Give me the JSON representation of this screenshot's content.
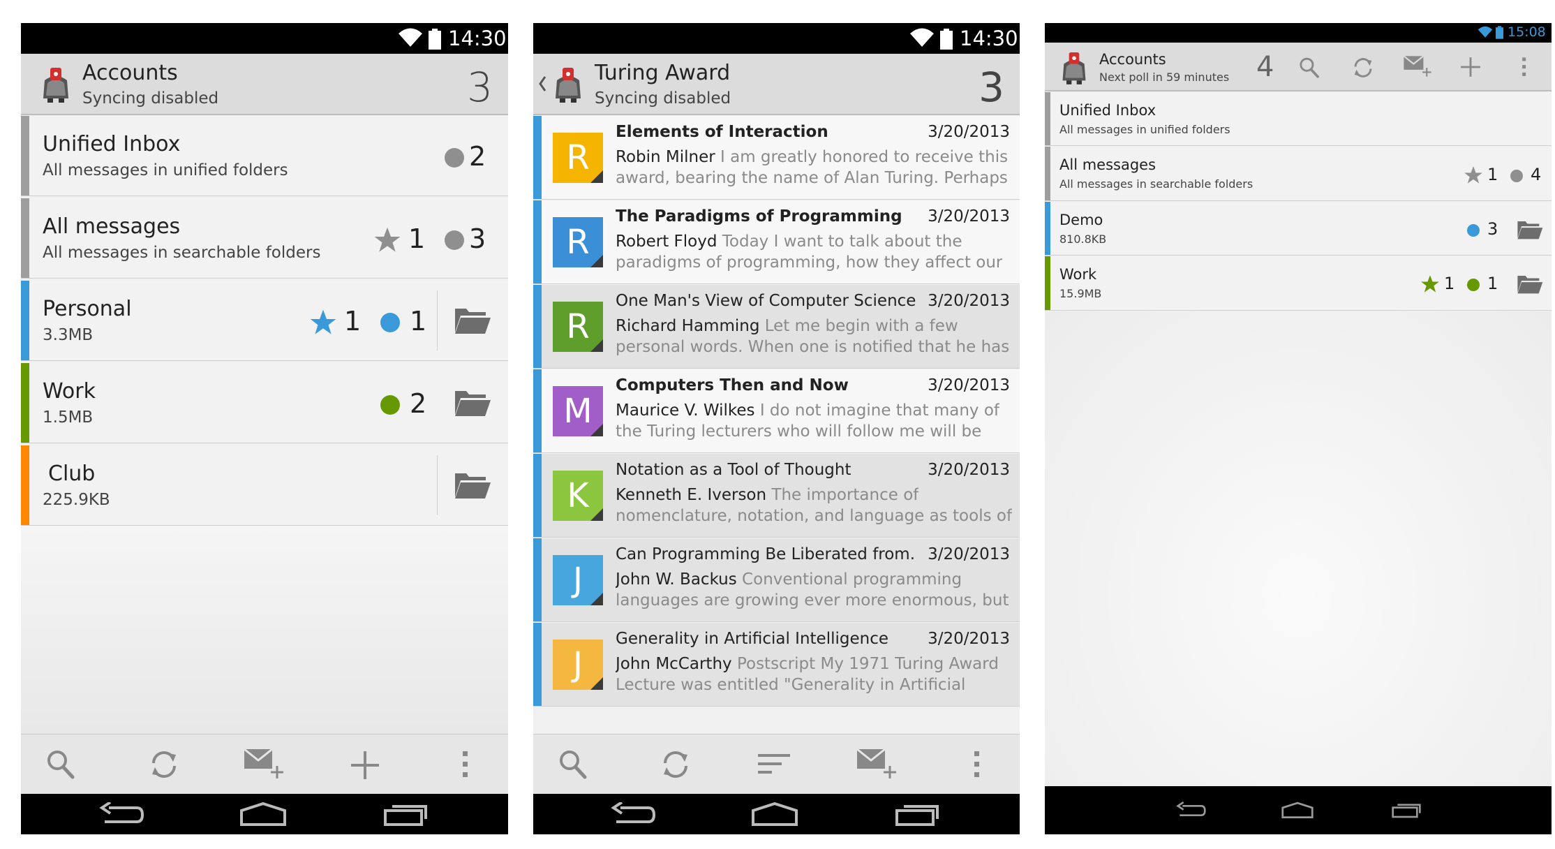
{
  "colors": {
    "unified": "#9e9e9e",
    "personal": "#3a9ad9",
    "work": "#669900",
    "club": "#ff8800",
    "demo": "#3a9ad9",
    "unread_grey": "#8f8f8f",
    "star_grey": "#8f8f8f",
    "star_blue": "#3a9ad9",
    "star_green": "#669900"
  },
  "screen1": {
    "status_time": "14:30",
    "title": "Accounts",
    "subtitle": "Syncing disabled",
    "count": "3",
    "accounts": [
      {
        "name": "Unified Inbox",
        "desc": "All messages in unified folders",
        "unread": "2"
      },
      {
        "name": "All messages",
        "desc": "All messages in searchable folders",
        "flagged": "1",
        "unread": "3"
      },
      {
        "name": "Personal",
        "desc": "3.3MB",
        "flagged": "1",
        "unread": "1"
      },
      {
        "name": "Work",
        "desc": "1.5MB",
        "unread": "2"
      },
      {
        "name": "Club",
        "desc": "225.9KB"
      }
    ],
    "toolbar_icons": [
      "search-icon",
      "refresh-icon",
      "compose-icon",
      "add-icon",
      "overflow-menu-icon"
    ]
  },
  "screen2": {
    "status_time": "14:30",
    "title": "Turing Award",
    "subtitle": "Syncing disabled",
    "count": "3",
    "messages": [
      {
        "letter": "R",
        "color": "#f4b400",
        "subject": "Elements of Interaction",
        "date": "3/20/2013",
        "sender": "Robin Milner",
        "preview1": " I am greatly honored to receive this",
        "preview2": "award, bearing the name of Alan Turing. Perhaps",
        "unread": true
      },
      {
        "letter": "R",
        "color": "#3a8fd6",
        "subject": "The Paradigms of Programming",
        "date": "3/20/2013",
        "sender": "Robert Floyd",
        "preview1": " Today I want to talk about the",
        "preview2": "paradigms of programming, how they affect our",
        "unread": true
      },
      {
        "letter": "R",
        "color": "#5f9e2b",
        "subject": "One Man's View of Computer Science",
        "date": "3/20/2013",
        "sender": "Richard Hamming",
        "preview1": " Let me begin with a few",
        "preview2": "personal words. When one is notified that he has",
        "unread": false
      },
      {
        "letter": "M",
        "color": "#a15ec9",
        "subject": "Computers Then and Now",
        "date": "3/20/2013",
        "sender": "Maurice V. Wilkes",
        "preview1": " I do not imagine that many of",
        "preview2": "the Turing lecturers who will follow me will be",
        "unread": true
      },
      {
        "letter": "K",
        "color": "#8cc63e",
        "subject": "Notation as a Tool of Thought",
        "date": "3/20/2013",
        "sender": "Kenneth E. Iverson",
        "preview1": " The importance of",
        "preview2": "nomenclature, notation, and language as tools of",
        "unread": false
      },
      {
        "letter": "J",
        "color": "#46a6dd",
        "subject": "Can Programming Be Liberated from..",
        "date": "3/20/2013",
        "sender": "John W. Backus",
        "preview1": " Conventional programming",
        "preview2": "languages are growing ever more enormous, but",
        "unread": false
      },
      {
        "letter": "J",
        "color": "#f4b840",
        "subject": "Generality in Artificial Intelligence",
        "date": "3/20/2013",
        "sender": "John McCarthy",
        "preview1": " Postscript My 1971 Turing Award",
        "preview2": "Lecture was entitled \"Generality in Artificial",
        "unread": false
      }
    ],
    "toolbar_icons": [
      "search-icon",
      "refresh-icon",
      "sort-icon",
      "compose-icon",
      "overflow-menu-icon"
    ]
  },
  "screen3": {
    "status_time": "15:08",
    "title": "Accounts",
    "subtitle": "Next poll in 59 minutes",
    "count": "4",
    "accounts": [
      {
        "name": "Unified Inbox",
        "desc": "All messages in unified folders"
      },
      {
        "name": "All messages",
        "desc": "All messages in searchable folders",
        "flagged": "1",
        "unread": "4"
      },
      {
        "name": "Demo",
        "desc": "810.8KB",
        "unread": "3"
      },
      {
        "name": "Work",
        "desc": "15.9MB",
        "flagged": "1",
        "unread": "1"
      }
    ],
    "toolbar_icons": [
      "search-icon",
      "refresh-icon",
      "compose-icon",
      "add-icon",
      "overflow-menu-icon"
    ]
  }
}
